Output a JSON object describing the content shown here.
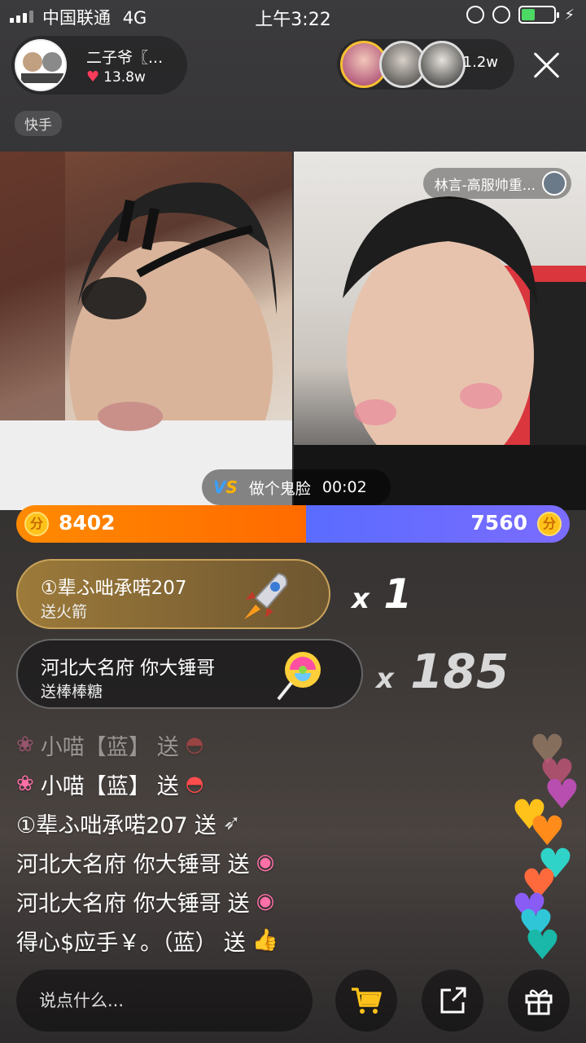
{
  "status_bar": {
    "carrier": "中国联通",
    "network": "4G",
    "time": "上午3:22",
    "battery_color": "#4cd964"
  },
  "host": {
    "name": "二子爷〖...",
    "likes": "13.8w",
    "platform_tag": "快手"
  },
  "viewers": {
    "count": "1.2w",
    "avatars": [
      "viewer-avatar-1",
      "viewer-avatar-2",
      "viewer-avatar-3"
    ]
  },
  "pk": {
    "rival_name": "林言-高服帅重...",
    "task_label": "做个鬼脸",
    "timer": "00:02",
    "left_score": "8402",
    "right_score": "7560",
    "coin_glyph": "分",
    "left_color": "#ff7a00",
    "right_color": "#6a6cff"
  },
  "gifts": [
    {
      "sender": "①辈ふ咄承喏207",
      "gift": "送火箭",
      "count": "1",
      "icon": "rocket-icon"
    },
    {
      "sender": "河北大名府 你大锤哥",
      "gift": "送棒棒糖",
      "count": "185",
      "icon": "lollipop-icon"
    }
  ],
  "comments": [
    {
      "user": "小喵【蓝】",
      "action": "送",
      "prefix_icon": "flower-icon",
      "gift_icon": "watermelon-icon",
      "faded": true
    },
    {
      "user": "小喵【蓝】",
      "action": "送",
      "prefix_icon": "flower-icon",
      "gift_icon": "watermelon-icon",
      "faded": false
    },
    {
      "user": "①辈ふ咄承喏207",
      "action": "送",
      "prefix_icon": "",
      "gift_icon": "rocket-icon",
      "faded": false
    },
    {
      "user": "河北大名府 你大锤哥",
      "action": "送",
      "prefix_icon": "",
      "gift_icon": "lollipop-icon",
      "faded": false
    },
    {
      "user": "河北大名府 你大锤哥",
      "action": "送",
      "prefix_icon": "",
      "gift_icon": "lollipop-icon",
      "faded": false
    },
    {
      "user": "得心$应手￥。（蓝）",
      "action": "送",
      "prefix_icon": "",
      "gift_icon": "thumbs-up-icon",
      "faded": false
    }
  ],
  "bottom_bar": {
    "input_placeholder": "说点什么...",
    "cart_color": "#ffc21a"
  }
}
